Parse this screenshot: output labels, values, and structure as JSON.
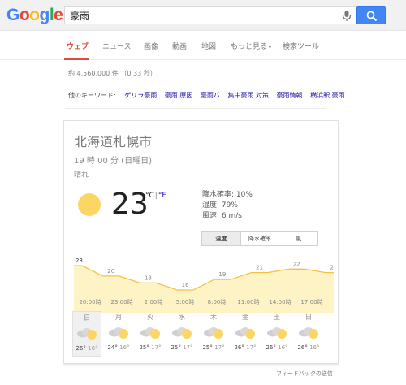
{
  "header": {
    "logo_letters": [
      {
        "ch": "G",
        "color": "#4285f4"
      },
      {
        "ch": "o",
        "color": "#ea4335"
      },
      {
        "ch": "o",
        "color": "#fbbc05"
      },
      {
        "ch": "g",
        "color": "#4285f4"
      },
      {
        "ch": "l",
        "color": "#34a853"
      },
      {
        "ch": "e",
        "color": "#ea4335"
      }
    ],
    "search_value": "豪雨",
    "mic_icon": "microphone-icon",
    "search_icon": "search-icon"
  },
  "tabs": [
    {
      "label": "ウェブ",
      "active": true
    },
    {
      "label": "ニュース"
    },
    {
      "label": "画像"
    },
    {
      "label": "動画"
    },
    {
      "label": "地図"
    },
    {
      "label": "もっと見る",
      "caret": "▾"
    },
    {
      "label": "検索ツール"
    }
  ],
  "result_stats": "約 4,560,000 件 （0.33 秒）",
  "keywords": {
    "label": "他のキーワード:",
    "links": [
      "ゲリラ豪雨",
      "豪雨 原因",
      "豪雨バ",
      "集中豪雨 対策",
      "豪雨情報",
      "横浜駅 豪雨"
    ]
  },
  "weather": {
    "city": "北海道札幌市",
    "time": "19 時 00 分 (日曜日)",
    "condition": "晴れ",
    "temperature": "23",
    "unit_c": "°C",
    "unit_sep": "|",
    "unit_f": "°F",
    "details": [
      "降水確率: 10%",
      "湿度: 79%",
      "風速: 6 m/s"
    ],
    "tabs": [
      {
        "label": "温度",
        "active": true
      },
      {
        "label": "降水確率"
      },
      {
        "label": "風"
      }
    ],
    "icon": "sun-icon",
    "accent_color": "#fcd664",
    "fill_color": "#fef3c5"
  },
  "chart_data": {
    "type": "area",
    "x": [
      "20:00",
      "23:00",
      "2:00",
      "5:00",
      "8:00",
      "11:00",
      "14:00",
      "17:00"
    ],
    "values": [
      23,
      20,
      18,
      16,
      19,
      21,
      22,
      21
    ],
    "labels_shown": [
      23,
      20,
      18,
      16,
      19,
      21,
      22,
      21
    ],
    "x_tick_labels": [
      "20:00時",
      "23:00時",
      "2:00時",
      "5:00時",
      "8:00時",
      "11:00時",
      "14:00時",
      "17:00時"
    ]
  },
  "forecast": [
    {
      "day": "日",
      "hi": "26°",
      "lo": "16°",
      "active": true
    },
    {
      "day": "月",
      "hi": "24°",
      "lo": "16°"
    },
    {
      "day": "火",
      "hi": "25°",
      "lo": "17°"
    },
    {
      "day": "水",
      "hi": "25°",
      "lo": "17°"
    },
    {
      "day": "木",
      "hi": "25°",
      "lo": "17°"
    },
    {
      "day": "金",
      "hi": "26°",
      "lo": "17°"
    },
    {
      "day": "土",
      "hi": "26°",
      "lo": "16°"
    },
    {
      "day": "日",
      "hi": "26°",
      "lo": "16°"
    }
  ],
  "forecast_icon": "partly-cloudy-icon",
  "feedback": "フィードバックの送信"
}
